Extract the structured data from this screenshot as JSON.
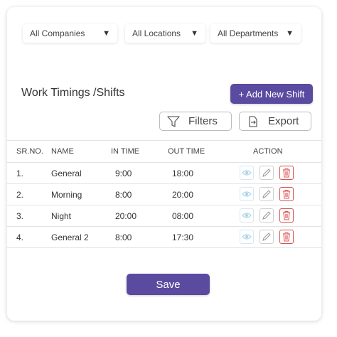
{
  "filters": {
    "companies": "All Companies",
    "locations": "All Locations",
    "departments": "All Departments"
  },
  "title": "Work Timings /Shifts",
  "add_button": "+ Add New Shift",
  "filters_button": "Filters",
  "export_button": "Export",
  "table": {
    "headers": [
      "SR.NO.",
      "NAME",
      "IN TIME",
      "OUT TIME",
      "ACTION"
    ],
    "rows": [
      {
        "sr": "1.",
        "name": "General",
        "in": "9:00",
        "out": "18:00"
      },
      {
        "sr": "2.",
        "name": "Morning",
        "in": "8:00",
        "out": "20:00"
      },
      {
        "sr": "3.",
        "name": "Night",
        "in": "20:00",
        "out": "08:00"
      },
      {
        "sr": "4.",
        "name": "General 2",
        "in": "8:00",
        "out": "17:30"
      }
    ]
  },
  "save_button": "Save",
  "colors": {
    "primary": "#5a4ba0",
    "delete": "#d9534f",
    "view": "#a9d3e6",
    "edit": "#9a9a9a"
  },
  "icons": {
    "dropdown": "caret-down-icon",
    "filter": "funnel-icon",
    "export": "export-icon",
    "view": "eye-icon",
    "edit": "pencil-icon",
    "delete": "trash-icon"
  }
}
